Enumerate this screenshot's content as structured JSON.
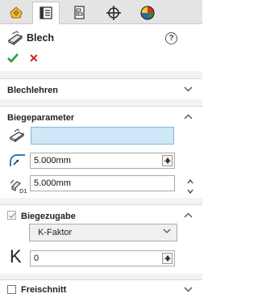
{
  "tabs": [
    {
      "name": "feature-manager",
      "icon": "feature-manager-icon"
    },
    {
      "name": "property-manager",
      "icon": "property-manager-icon"
    },
    {
      "name": "configuration-manager",
      "icon": "configuration-manager-icon"
    },
    {
      "name": "dimxpert-manager",
      "icon": "crosshair-icon"
    },
    {
      "name": "display-manager",
      "icon": "appearance-sphere-icon"
    }
  ],
  "header": {
    "title": "Blech",
    "help": "?",
    "ok": "✔",
    "cancel": "✕"
  },
  "sections": {
    "blechlehren": {
      "title": "Blechlehren"
    },
    "biegeparameter": {
      "title": "Biegeparameter",
      "face_value": "",
      "radius_value": "5.000mm",
      "thickness_value": "5.000mm"
    },
    "biegezugabe": {
      "title": "Biegezugabe",
      "checked": true,
      "type_value": "K-Faktor",
      "k_symbol": "K",
      "k_value": "0"
    },
    "freischnitt": {
      "title": "Freischnitt",
      "checked": false
    }
  },
  "colors": {
    "accent_field_fill": "#cfe8f8",
    "accent_field_border": "#7fb9e1",
    "ok_green": "#2e9b3a",
    "cancel_red": "#d02020"
  }
}
